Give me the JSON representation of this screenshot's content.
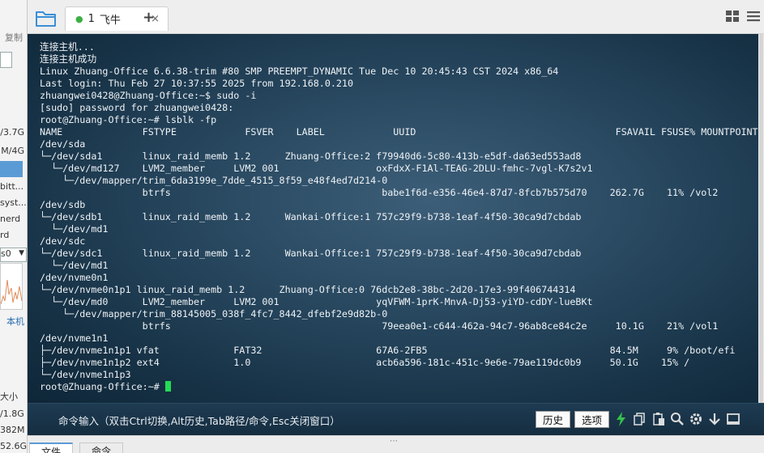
{
  "left_panel": {
    "copy_label": "复制",
    "partial_texts": [
      "/3.7G",
      "M/4G",
      "bitt...",
      "syst...",
      "nerd",
      "rd",
      "s0",
      "本机",
      "大小",
      "/1.8G",
      "382M",
      "52.6G"
    ]
  },
  "tabbar": {
    "tab": {
      "number": "1",
      "title": "飞牛"
    },
    "close_symbol": "×",
    "add_symbol": "+"
  },
  "terminal": {
    "lines": [
      "连接主机...",
      "连接主机成功",
      "Linux Zhuang-Office 6.6.38-trim #80 SMP PREEMPT_DYNAMIC Tue Dec 10 20:45:43 CST 2024 x86_64",
      "Last login: Thu Feb 27 10:37:55 2025 from 192.168.0.210",
      "zhuangwei0428@Zhuang-Office:~$ sudo -i",
      "[sudo] password for zhuangwei0428:",
      "root@Zhuang-Office:~# lsblk -fp",
      "NAME              FSTYPE            FSVER    LABEL            UUID                                   FSAVAIL FSUSE% MOUNTPOINTS",
      "/dev/sda",
      "└─/dev/sda1       linux_raid_memb 1.2      Zhuang-Office:2 f79940d6-5c80-413b-e5df-da63ed553ad8",
      "  └─/dev/md127    LVM2_member     LVM2 001                 oxFdxX-F1Al-TEAG-2DLU-fmhc-7vgl-K7s2v1",
      "    └─/dev/mapper/trim_6da3199e_7dde_4515_8f59_e48f4ed7d214-0",
      "                  btrfs                                     babe1f6d-e356-46e4-87d7-8fcb7b575d70    262.7G    11% /vol2",
      "/dev/sdb",
      "└─/dev/sdb1       linux_raid_memb 1.2      Wankai-Office:1 757c29f9-b738-1eaf-4f50-30ca9d7cbdab",
      "  └─/dev/md1",
      "/dev/sdc",
      "└─/dev/sdc1       linux_raid_memb 1.2      Wankai-Office:1 757c29f9-b738-1eaf-4f50-30ca9d7cbdab",
      "  └─/dev/md1",
      "/dev/nvme0n1",
      "└─/dev/nvme0n1p1 linux_raid_memb 1.2      Zhuang-Office:0 76dcb2e8-38bc-2d20-17e3-99f406744314",
      "  └─/dev/md0      LVM2_member     LVM2 001                 yqVFWM-1prK-MnvA-Dj53-yiYD-cdDY-lueBKt",
      "    └─/dev/mapper/trim_88145005_038f_4fc7_8442_dfebf2e9d82b-0",
      "                  btrfs                                     79eea0e1-c644-462a-94c7-96ab8ce84c2e     10.1G    21% /vol1",
      "/dev/nvme1n1",
      "├─/dev/nvme1n1p1 vfat             FAT32                    67A6-2FB5                                84.5M     9% /boot/efi",
      "├─/dev/nvme1n1p2 ext4             1.0                      acb6a596-181c-451c-9e6e-79ae119dc0b9     50.1G    15% /",
      "└─/dev/nvme1n1p3"
    ],
    "prompt": "root@Zhuang-Office:~# "
  },
  "command_bar": {
    "hint": "命令输入（双击Ctrl切换,Alt历史,Tab路径/命令,Esc关闭窗口）",
    "history_label": "历史",
    "options_label": "选项"
  },
  "bottom_tabs": [
    "文件",
    "命令"
  ],
  "colors": {
    "terminal_text": "#eef2f5",
    "cursor": "#22dd55",
    "tab_active_dot": "#3cb043",
    "accent": "#5b9bd5"
  }
}
